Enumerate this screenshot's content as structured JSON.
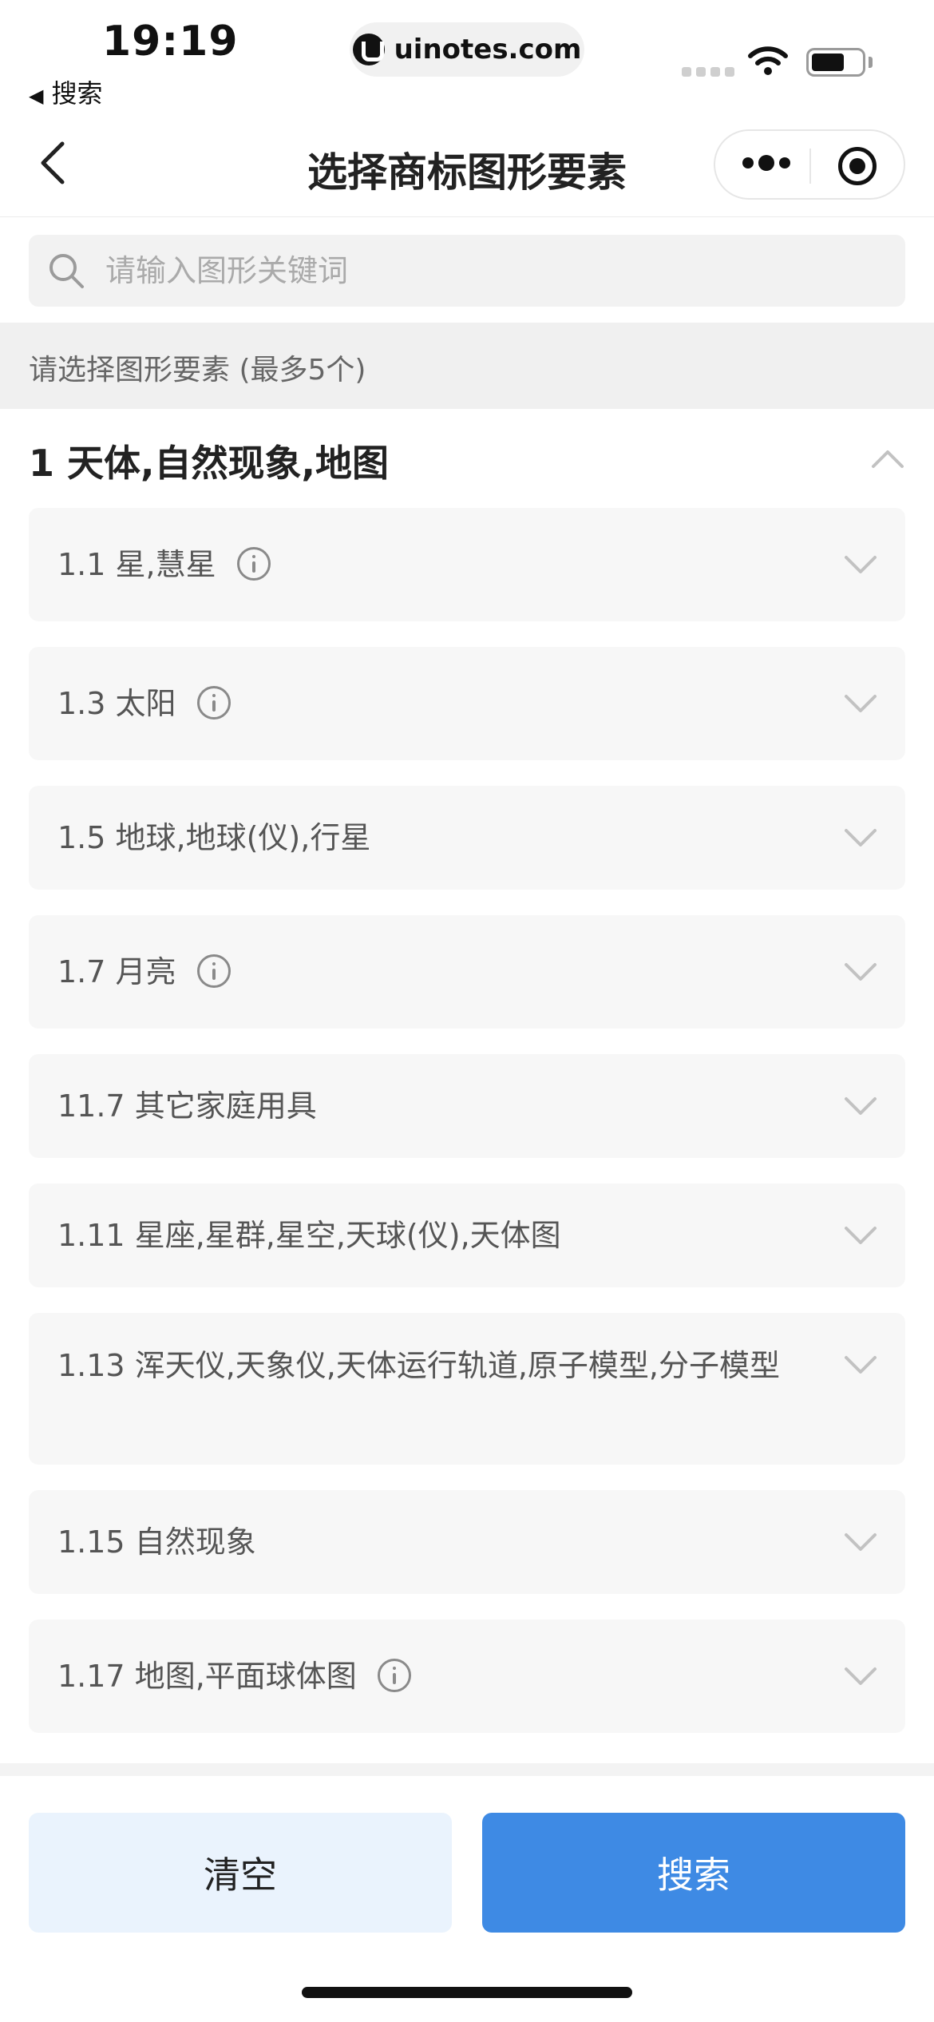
{
  "status_bar": {
    "time": "19:19",
    "back_app": "搜索",
    "url": "uinotes.com"
  },
  "nav": {
    "title": "选择商标图形要素"
  },
  "search": {
    "placeholder": "请输入图形关键词",
    "value": ""
  },
  "hint": "请选择图形要素 (最多5个)",
  "category": {
    "title": "1 天体,自然现象,地图",
    "expanded": true,
    "items": [
      {
        "label": "1.1 星,慧星",
        "has_info": true
      },
      {
        "label": "1.3 太阳",
        "has_info": true
      },
      {
        "label": "1.5 地球,地球(仪),行星",
        "has_info": false
      },
      {
        "label": "1.7 月亮",
        "has_info": true
      },
      {
        "label": "11.7 其它家庭用具",
        "has_info": false
      },
      {
        "label": "1.11 星座,星群,星空,天球(仪),天体图",
        "has_info": false
      },
      {
        "label": "1.13 浑天仪,天象仪,天体运行轨道,原子模型,分子模型",
        "has_info": false
      },
      {
        "label": "1.15 自然现象",
        "has_info": false
      },
      {
        "label": "1.17 地图,平面球体图",
        "has_info": true
      }
    ]
  },
  "actions": {
    "clear_label": "清空",
    "search_label": "搜索"
  },
  "colors": {
    "accent": "#3e8ae4",
    "clear_bg": "#eaf3fd",
    "item_bg": "#f7f7f7"
  }
}
